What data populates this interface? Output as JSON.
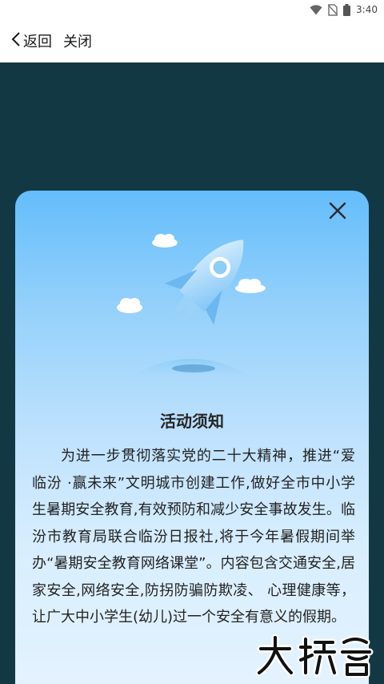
{
  "status_bar": {
    "time": "3:40",
    "icons": [
      "wifi-icon",
      "no-sim-icon",
      "battery-icon"
    ]
  },
  "nav": {
    "back_label": "返回",
    "close_label": "关闭"
  },
  "modal": {
    "title": "活动须知",
    "body": "为进一步贯彻落实党的二十大精神，推进“爱临汾 ·赢未来”文明城市创建工作,做好全市中小学生暑期安全教育,有效预防和减少安全事故发生。临汾市教育局联合临汾日报社,将于今年暑假期间举办“暑期安全教育网络课堂”。内容包含交通安全,居家安全,网络安全,防拐防骗防欺凌、 心理健康等，让广大中小学生(幼儿)过一个安全有意义的假期。",
    "close_icon": "close-icon",
    "illustration": "rocket-illustration"
  },
  "watermark": {
    "text": "大榜客"
  },
  "colors": {
    "overlay": "#123844",
    "modal_top": "#64bdfb",
    "modal_bottom": "#e5f3fe",
    "title_text": "#262626"
  }
}
